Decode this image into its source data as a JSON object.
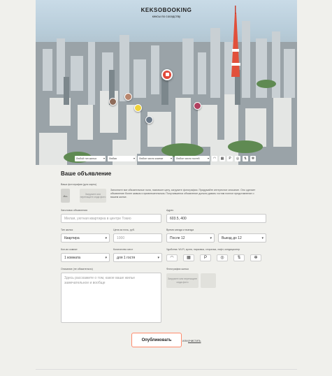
{
  "brand": {
    "name": "KEKSOBOOKING",
    "tagline": "кексы по соседству"
  },
  "filters": {
    "type": "Любой тип жилья",
    "price": "Любая",
    "rooms": "Любое число комнат",
    "guests": "Любое число гостей",
    "features": [
      "wifi-icon",
      "dishwasher-icon",
      "parking-icon",
      "washer-icon",
      "elevator-icon",
      "conditioner-icon"
    ]
  },
  "form": {
    "title": "Ваше объявление",
    "avatar_label": "Ваша фотография (для карты)",
    "avatar_drop": "Загрузите или перетащите сюда фото",
    "avatar_hint": "Заполните все обязательные поля, назначьте цену, загрузите фотографии. Придумайте интересное описание. Оно сделает объявление более живым и привлекательным. Получившееся объявление должно давать гостям полное представление о вашем жилье.",
    "ad_title_label": "Заголовок объявления",
    "ad_title_placeholder": "Милая, уютная квартирка в центре Токио",
    "address_label": "Адрес",
    "address_value": "603.5, 400",
    "type_label": "Тип жилья",
    "type_value": "Квартира",
    "price_label": "Цена за ночь, руб.",
    "price_placeholder": "1000",
    "time_label": "Время заезда и выезда",
    "checkin_value": "После 12",
    "checkout_value": "Выезд до 12",
    "rooms_label": "Кол-во комнат",
    "rooms_value": "1 комната",
    "capacity_label": "Количество мест",
    "capacity_value": "для 1 гостя",
    "features_label": "Удобства: Wi-Fi, кухня, парковка, стиралка, лифт, кондиционер",
    "features": [
      "wifi-icon",
      "dishwasher-icon",
      "parking-icon",
      "washer-icon",
      "elevator-icon",
      "conditioner-icon"
    ],
    "description_label": "Описание (не обязательно)",
    "description_placeholder": "Здесь расскажите о том, какое ваше жилье замечательное и вообще",
    "photos_label": "Фотографии жилья",
    "photos_drop": "Загрузите или перетащите сюда фото",
    "submit_label": "Опубликовать",
    "or_label": "или",
    "reset_label": "очистить"
  },
  "colors": {
    "accent": "#ff6547",
    "background": "#f0f0ec",
    "pin": "#e14a3b"
  }
}
